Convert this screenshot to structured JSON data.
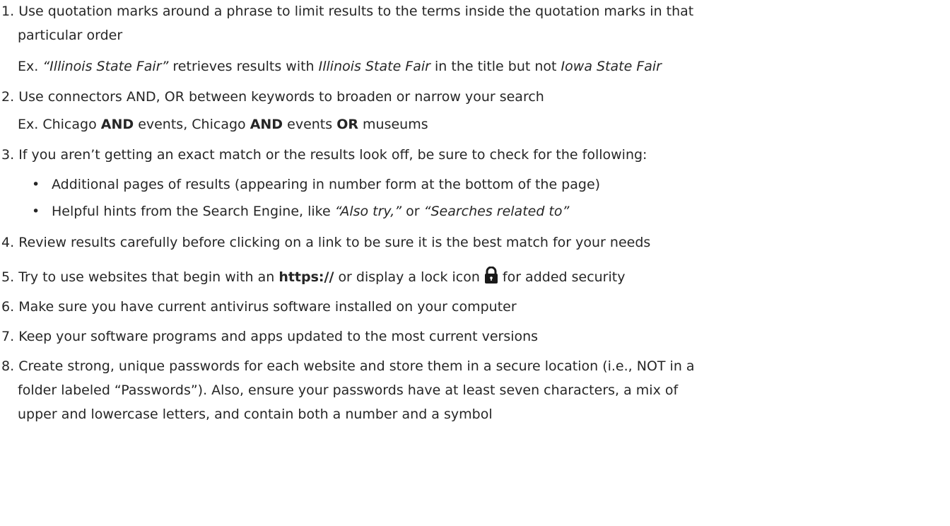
{
  "items": [
    {
      "number": "1.",
      "lines": [
        "Use quotation marks around a phrase to limit results to the terms inside the quotation marks in that",
        "particular order"
      ],
      "example": {
        "prefix": "Ex.",
        "quoted": "“Illinois State Fair”",
        "mid1": "retrieves results with",
        "term1": "Illinois State Fair",
        "mid2": "in the title but not",
        "term2": "Iowa State Fair"
      }
    },
    {
      "number": "2.",
      "text": "Use connectors AND, OR between keywords to broaden or narrow your search",
      "example": {
        "prefix": "Ex. Chicago",
        "and1": "AND",
        "mid1": "events, Chicago",
        "and2": "AND",
        "mid2": "events",
        "or": "OR",
        "end": "museums"
      }
    },
    {
      "number": "3.",
      "text": "If you aren’t getting an exact match or the results look off, be sure to check for the following:",
      "bullets": [
        {
          "text": "Additional pages of results (appearing in number form at the bottom of the page)"
        },
        {
          "lead": "Helpful hints from the Search Engine, like",
          "q1": "“Also try,”",
          "mid": "or",
          "q2": "“Searches related to”"
        }
      ],
      "bullet_char": "•"
    },
    {
      "number": "4.",
      "text": "Review results carefully before clicking on a link to be sure it is the best match for your needs"
    },
    {
      "number": "5.",
      "before": "Try to use websites that begin with an",
      "bold": "https://",
      "middle": "or display a lock icon",
      "after": "for added security",
      "icon": "lock-icon"
    },
    {
      "number": "6.",
      "text": "Make sure you have current antivirus software installed on your computer"
    },
    {
      "number": "7.",
      "text": "Keep your software programs and apps updated to the most current versions"
    },
    {
      "number": "8.",
      "lines": [
        "Create strong, unique passwords for each website and store them in a secure location (i.e., NOT in a",
        "folder labeled “Passwords”). Also, ensure your passwords have at least seven characters, a mix of",
        "upper and lowercase letters, and contain both a number and a symbol"
      ]
    }
  ]
}
